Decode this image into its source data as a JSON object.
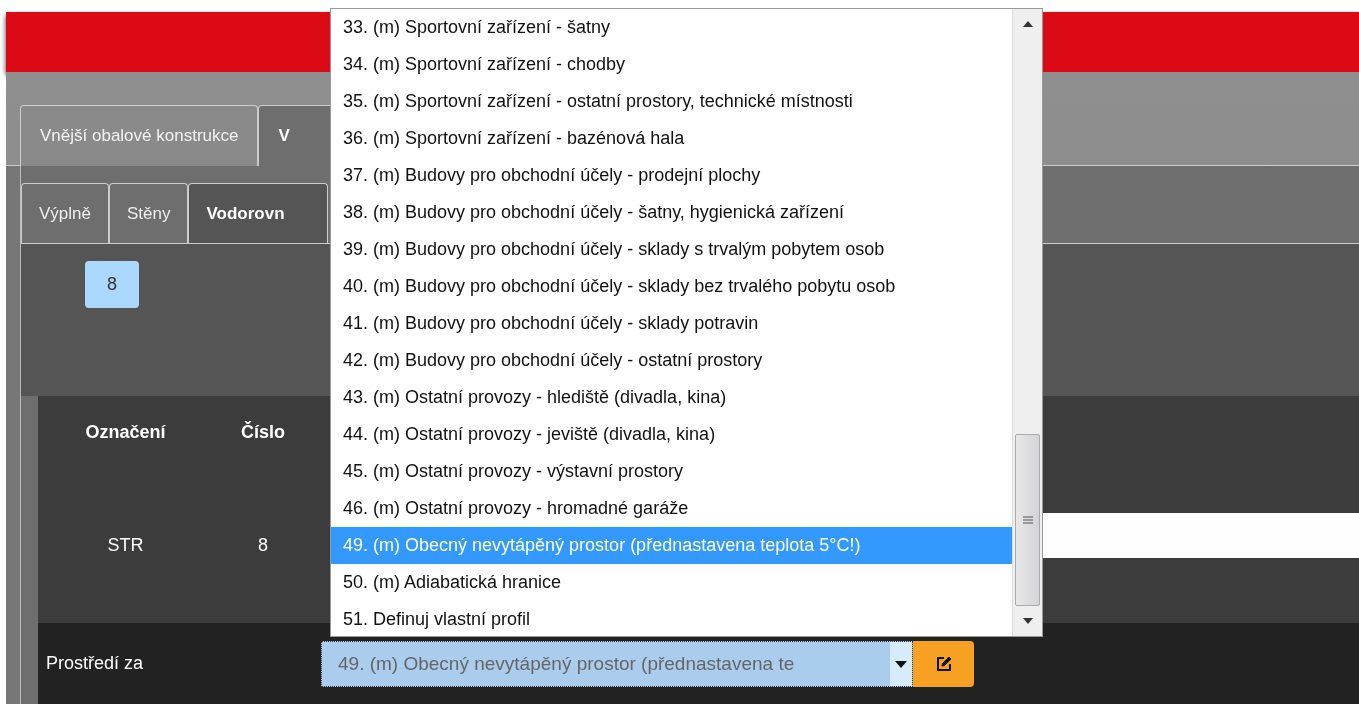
{
  "outer_tabs": [
    {
      "label": "Vnější obalové konstrukce",
      "selected": false
    },
    {
      "label": "V",
      "selected": true
    }
  ],
  "inner_tabs": [
    {
      "label": "Výplně",
      "selected": false
    },
    {
      "label": "Stěny",
      "selected": false
    },
    {
      "label": "Vodorovn",
      "selected": true
    }
  ],
  "badge": "8",
  "table": {
    "columns": [
      "Označení",
      "Číslo"
    ],
    "rows": [
      [
        "STR",
        "8"
      ]
    ]
  },
  "environment": {
    "label": "Prostředí za",
    "value": "49. (m) Obecný nevytápěný prostor (přednastavena te"
  },
  "dropdown": {
    "options": [
      {
        "label": "33. (m) Sportovní zařízení - šatny",
        "selected": false
      },
      {
        "label": "34. (m) Sportovní zařízení - chodby",
        "selected": false
      },
      {
        "label": "35. (m) Sportovní zařízení - ostatní prostory, technické místnosti",
        "selected": false
      },
      {
        "label": "36. (m) Sportovní zařízení - bazénová hala",
        "selected": false
      },
      {
        "label": "37. (m) Budovy pro obchodní účely - prodejní plochy",
        "selected": false
      },
      {
        "label": "38. (m) Budovy pro obchodní účely - šatny, hygienická zařízení",
        "selected": false
      },
      {
        "label": "39. (m) Budovy pro obchodní účely - sklady s trvalým pobytem osob",
        "selected": false
      },
      {
        "label": "40. (m) Budovy pro obchodní účely - sklady bez trvalého pobytu osob",
        "selected": false
      },
      {
        "label": "41. (m) Budovy pro obchodní účely - sklady potravin",
        "selected": false
      },
      {
        "label": "42. (m) Budovy pro obchodní účely - ostatní prostory",
        "selected": false
      },
      {
        "label": "43. (m) Ostatní provozy - hlediště (divadla, kina)",
        "selected": false
      },
      {
        "label": "44. (m) Ostatní provozy - jeviště (divadla, kina)",
        "selected": false
      },
      {
        "label": "45. (m) Ostatní provozy - výstavní prostory",
        "selected": false
      },
      {
        "label": "46. (m) Ostatní provozy - hromadné garáže",
        "selected": false
      },
      {
        "label": "49. (m) Obecný nevytápěný prostor (přednastavena teplota 5°C!)",
        "selected": true
      },
      {
        "label": "50. (m) Adiabatická hranice",
        "selected": false
      },
      {
        "label": "51. Definuj vlastní profil",
        "selected": false
      }
    ]
  }
}
